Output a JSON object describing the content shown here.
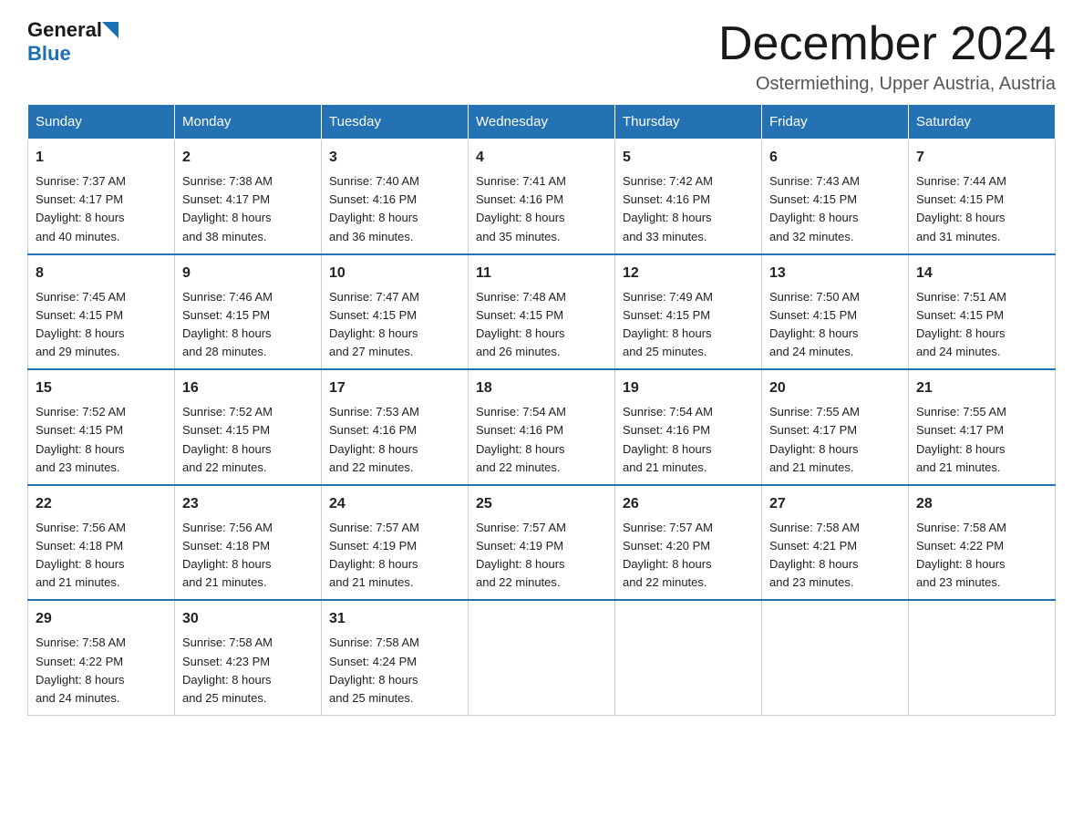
{
  "logo": {
    "general": "General",
    "blue": "Blue"
  },
  "title": {
    "month": "December 2024",
    "location": "Ostermiething, Upper Austria, Austria"
  },
  "weekdays": [
    "Sunday",
    "Monday",
    "Tuesday",
    "Wednesday",
    "Thursday",
    "Friday",
    "Saturday"
  ],
  "weeks": [
    [
      {
        "day": "1",
        "sunrise": "Sunrise: 7:37 AM",
        "sunset": "Sunset: 4:17 PM",
        "daylight": "Daylight: 8 hours",
        "daylight2": "and 40 minutes."
      },
      {
        "day": "2",
        "sunrise": "Sunrise: 7:38 AM",
        "sunset": "Sunset: 4:17 PM",
        "daylight": "Daylight: 8 hours",
        "daylight2": "and 38 minutes."
      },
      {
        "day": "3",
        "sunrise": "Sunrise: 7:40 AM",
        "sunset": "Sunset: 4:16 PM",
        "daylight": "Daylight: 8 hours",
        "daylight2": "and 36 minutes."
      },
      {
        "day": "4",
        "sunrise": "Sunrise: 7:41 AM",
        "sunset": "Sunset: 4:16 PM",
        "daylight": "Daylight: 8 hours",
        "daylight2": "and 35 minutes."
      },
      {
        "day": "5",
        "sunrise": "Sunrise: 7:42 AM",
        "sunset": "Sunset: 4:16 PM",
        "daylight": "Daylight: 8 hours",
        "daylight2": "and 33 minutes."
      },
      {
        "day": "6",
        "sunrise": "Sunrise: 7:43 AM",
        "sunset": "Sunset: 4:15 PM",
        "daylight": "Daylight: 8 hours",
        "daylight2": "and 32 minutes."
      },
      {
        "day": "7",
        "sunrise": "Sunrise: 7:44 AM",
        "sunset": "Sunset: 4:15 PM",
        "daylight": "Daylight: 8 hours",
        "daylight2": "and 31 minutes."
      }
    ],
    [
      {
        "day": "8",
        "sunrise": "Sunrise: 7:45 AM",
        "sunset": "Sunset: 4:15 PM",
        "daylight": "Daylight: 8 hours",
        "daylight2": "and 29 minutes."
      },
      {
        "day": "9",
        "sunrise": "Sunrise: 7:46 AM",
        "sunset": "Sunset: 4:15 PM",
        "daylight": "Daylight: 8 hours",
        "daylight2": "and 28 minutes."
      },
      {
        "day": "10",
        "sunrise": "Sunrise: 7:47 AM",
        "sunset": "Sunset: 4:15 PM",
        "daylight": "Daylight: 8 hours",
        "daylight2": "and 27 minutes."
      },
      {
        "day": "11",
        "sunrise": "Sunrise: 7:48 AM",
        "sunset": "Sunset: 4:15 PM",
        "daylight": "Daylight: 8 hours",
        "daylight2": "and 26 minutes."
      },
      {
        "day": "12",
        "sunrise": "Sunrise: 7:49 AM",
        "sunset": "Sunset: 4:15 PM",
        "daylight": "Daylight: 8 hours",
        "daylight2": "and 25 minutes."
      },
      {
        "day": "13",
        "sunrise": "Sunrise: 7:50 AM",
        "sunset": "Sunset: 4:15 PM",
        "daylight": "Daylight: 8 hours",
        "daylight2": "and 24 minutes."
      },
      {
        "day": "14",
        "sunrise": "Sunrise: 7:51 AM",
        "sunset": "Sunset: 4:15 PM",
        "daylight": "Daylight: 8 hours",
        "daylight2": "and 24 minutes."
      }
    ],
    [
      {
        "day": "15",
        "sunrise": "Sunrise: 7:52 AM",
        "sunset": "Sunset: 4:15 PM",
        "daylight": "Daylight: 8 hours",
        "daylight2": "and 23 minutes."
      },
      {
        "day": "16",
        "sunrise": "Sunrise: 7:52 AM",
        "sunset": "Sunset: 4:15 PM",
        "daylight": "Daylight: 8 hours",
        "daylight2": "and 22 minutes."
      },
      {
        "day": "17",
        "sunrise": "Sunrise: 7:53 AM",
        "sunset": "Sunset: 4:16 PM",
        "daylight": "Daylight: 8 hours",
        "daylight2": "and 22 minutes."
      },
      {
        "day": "18",
        "sunrise": "Sunrise: 7:54 AM",
        "sunset": "Sunset: 4:16 PM",
        "daylight": "Daylight: 8 hours",
        "daylight2": "and 22 minutes."
      },
      {
        "day": "19",
        "sunrise": "Sunrise: 7:54 AM",
        "sunset": "Sunset: 4:16 PM",
        "daylight": "Daylight: 8 hours",
        "daylight2": "and 21 minutes."
      },
      {
        "day": "20",
        "sunrise": "Sunrise: 7:55 AM",
        "sunset": "Sunset: 4:17 PM",
        "daylight": "Daylight: 8 hours",
        "daylight2": "and 21 minutes."
      },
      {
        "day": "21",
        "sunrise": "Sunrise: 7:55 AM",
        "sunset": "Sunset: 4:17 PM",
        "daylight": "Daylight: 8 hours",
        "daylight2": "and 21 minutes."
      }
    ],
    [
      {
        "day": "22",
        "sunrise": "Sunrise: 7:56 AM",
        "sunset": "Sunset: 4:18 PM",
        "daylight": "Daylight: 8 hours",
        "daylight2": "and 21 minutes."
      },
      {
        "day": "23",
        "sunrise": "Sunrise: 7:56 AM",
        "sunset": "Sunset: 4:18 PM",
        "daylight": "Daylight: 8 hours",
        "daylight2": "and 21 minutes."
      },
      {
        "day": "24",
        "sunrise": "Sunrise: 7:57 AM",
        "sunset": "Sunset: 4:19 PM",
        "daylight": "Daylight: 8 hours",
        "daylight2": "and 21 minutes."
      },
      {
        "day": "25",
        "sunrise": "Sunrise: 7:57 AM",
        "sunset": "Sunset: 4:19 PM",
        "daylight": "Daylight: 8 hours",
        "daylight2": "and 22 minutes."
      },
      {
        "day": "26",
        "sunrise": "Sunrise: 7:57 AM",
        "sunset": "Sunset: 4:20 PM",
        "daylight": "Daylight: 8 hours",
        "daylight2": "and 22 minutes."
      },
      {
        "day": "27",
        "sunrise": "Sunrise: 7:58 AM",
        "sunset": "Sunset: 4:21 PM",
        "daylight": "Daylight: 8 hours",
        "daylight2": "and 23 minutes."
      },
      {
        "day": "28",
        "sunrise": "Sunrise: 7:58 AM",
        "sunset": "Sunset: 4:22 PM",
        "daylight": "Daylight: 8 hours",
        "daylight2": "and 23 minutes."
      }
    ],
    [
      {
        "day": "29",
        "sunrise": "Sunrise: 7:58 AM",
        "sunset": "Sunset: 4:22 PM",
        "daylight": "Daylight: 8 hours",
        "daylight2": "and 24 minutes."
      },
      {
        "day": "30",
        "sunrise": "Sunrise: 7:58 AM",
        "sunset": "Sunset: 4:23 PM",
        "daylight": "Daylight: 8 hours",
        "daylight2": "and 25 minutes."
      },
      {
        "day": "31",
        "sunrise": "Sunrise: 7:58 AM",
        "sunset": "Sunset: 4:24 PM",
        "daylight": "Daylight: 8 hours",
        "daylight2": "and 25 minutes."
      },
      null,
      null,
      null,
      null
    ]
  ]
}
